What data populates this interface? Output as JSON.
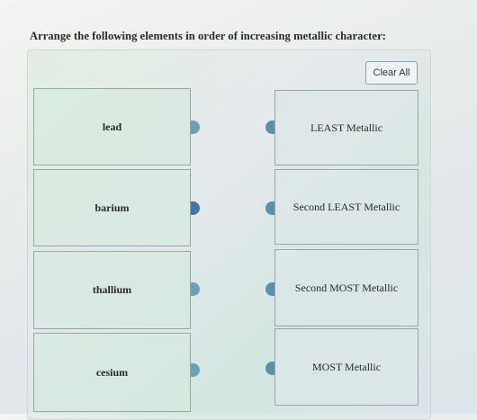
{
  "question": {
    "text": "Arrange the following elements in order of increasing metallic character:"
  },
  "controls": {
    "clear_all_label": "Clear All"
  },
  "elements": [
    {
      "label": "lead"
    },
    {
      "label": "barium"
    },
    {
      "label": "thallium"
    },
    {
      "label": "cesium"
    }
  ],
  "targets": [
    {
      "label": "LEAST Metallic"
    },
    {
      "label": "Second LEAST Metallic"
    },
    {
      "label": "Second MOST Metallic"
    },
    {
      "label": "MOST Metallic"
    }
  ],
  "colors": {
    "connector": "#6f9fb6",
    "connector_dark": "#3f78a8"
  }
}
